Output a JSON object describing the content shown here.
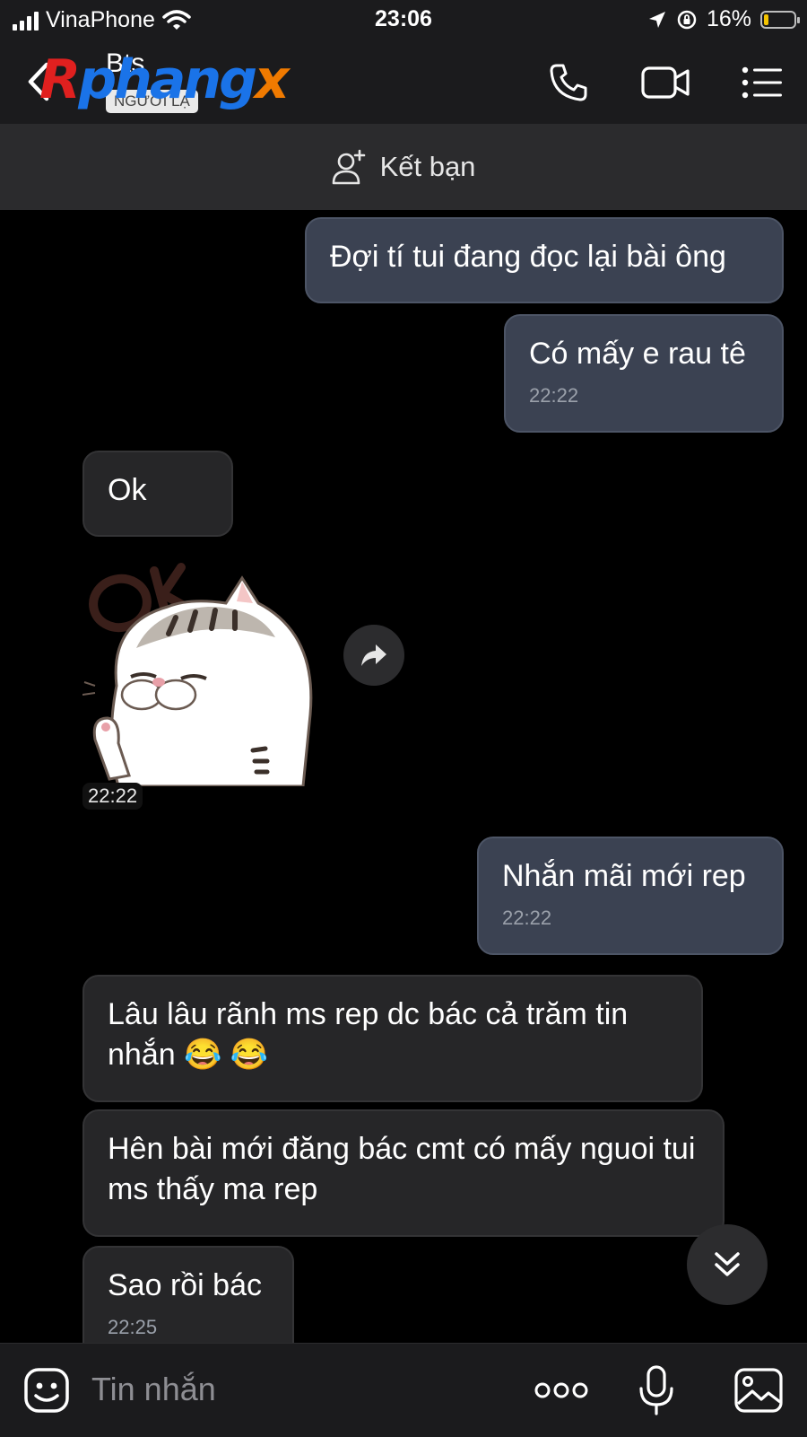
{
  "status_bar": {
    "carrier": "VinaPhone",
    "time": "23:06",
    "battery_percent_text": "16%",
    "battery_level": 0.16,
    "battery_color": "#f5c400"
  },
  "header": {
    "contact_name": "Bts",
    "badge": "NGƯỜI LẠ",
    "watermark": {
      "part1": "R",
      "part2": "phang",
      "part3": "x"
    },
    "icons": [
      "back-chevron-icon",
      "phone-icon",
      "video-camera-icon",
      "menu-list-icon"
    ]
  },
  "friend_bar": {
    "label": "Kết bạn",
    "icon": "add-user-icon"
  },
  "messages": [
    {
      "dir": "out",
      "text": "Đợi tí tui đang đọc lại bài ông"
    },
    {
      "dir": "out",
      "text": "Có mấy e rau tê",
      "time": "22:22"
    },
    {
      "dir": "in",
      "text": "Ok"
    },
    {
      "dir": "in",
      "type": "sticker",
      "sticker": "cat-ok-sticker",
      "time": "22:22"
    },
    {
      "dir": "out",
      "text": "Nhắn mãi mới rep",
      "time": "22:22"
    },
    {
      "dir": "in",
      "text": "Lâu lâu rãnh ms rep dc bác cả trăm tin nhắn 😂 😂"
    },
    {
      "dir": "in",
      "text": "Hên bài mới đăng bác cmt có mấy nguoi tui ms thấy ma rep"
    },
    {
      "dir": "in",
      "text": "Sao rồi bác",
      "time": "22:25"
    }
  ],
  "input_bar": {
    "placeholder": "Tin nhắn",
    "icons": [
      "emoji-sticker-icon",
      "more-dots-icon",
      "microphone-icon",
      "image-gallery-icon"
    ]
  },
  "colors": {
    "background": "#000000",
    "bar_background": "#1b1b1d",
    "outgoing_bubble": "#3b4252",
    "incoming_bubble": "#262628"
  }
}
